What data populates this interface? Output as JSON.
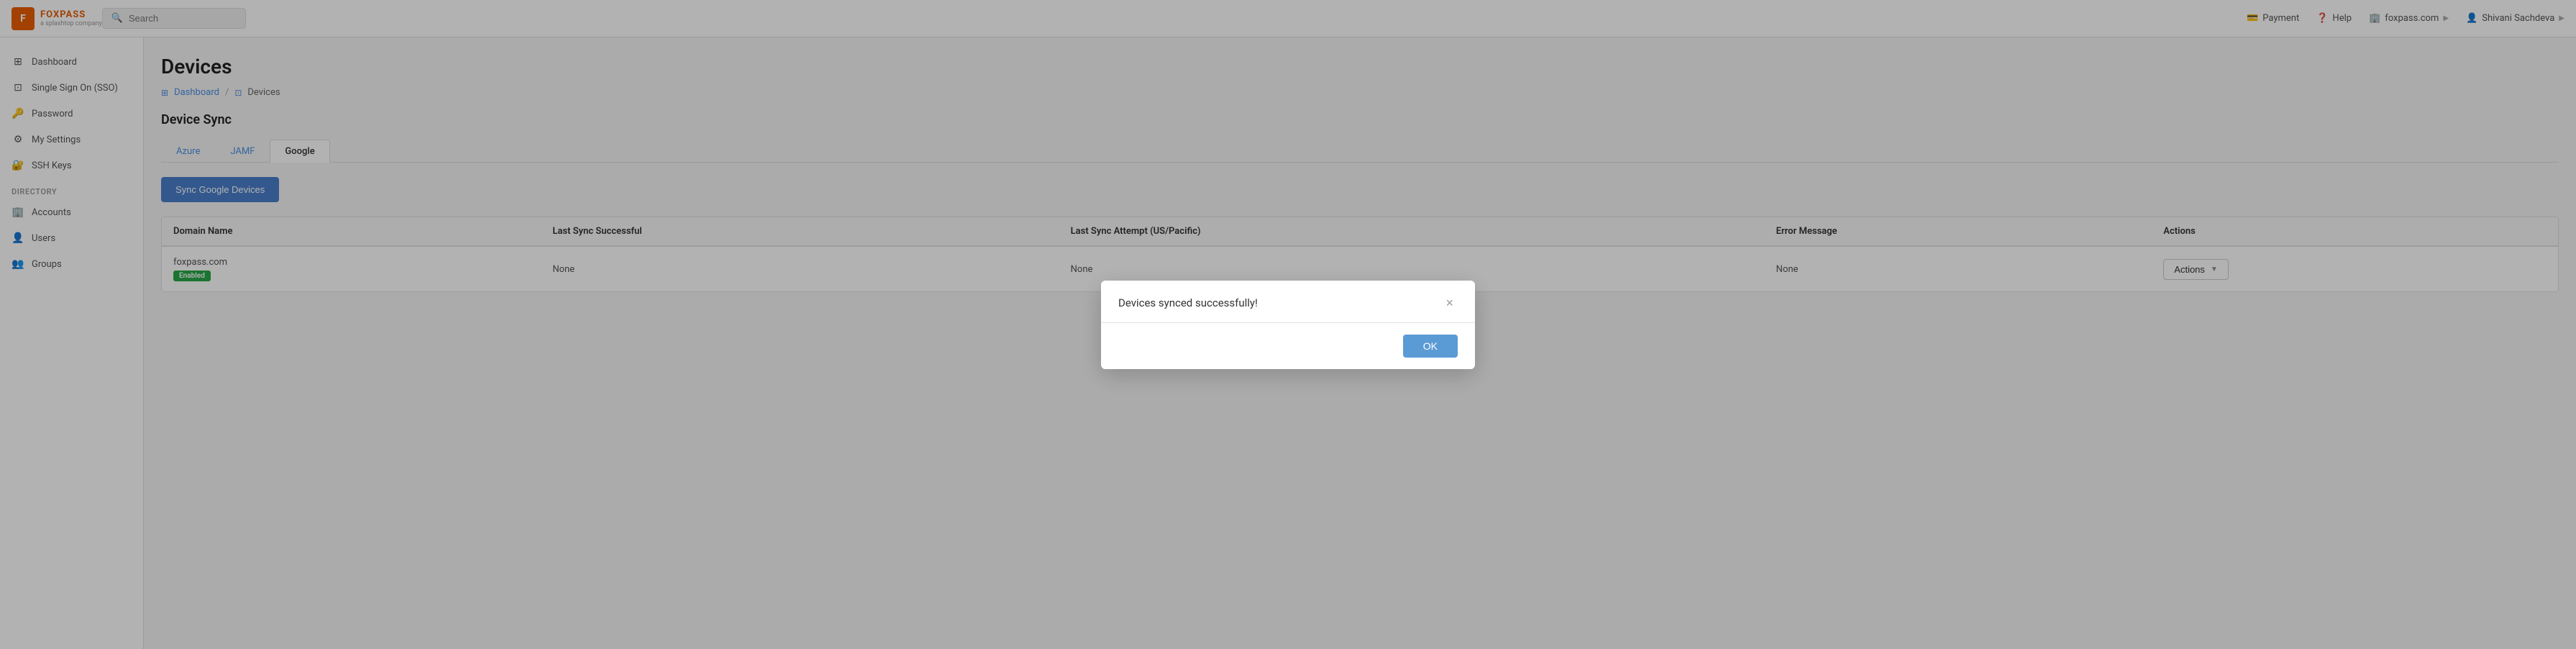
{
  "app": {
    "logo_text": "FOXPASS",
    "logo_sub": "a splashtop company"
  },
  "topnav": {
    "search_placeholder": "Search",
    "payment_label": "Payment",
    "help_label": "Help",
    "domain_label": "foxpass.com",
    "user_label": "Shivani Sachdeva"
  },
  "sidebar": {
    "items": [
      {
        "id": "dashboard",
        "label": "Dashboard",
        "icon": "⊞"
      },
      {
        "id": "sso",
        "label": "Single Sign On (SSO)",
        "icon": "⊡"
      },
      {
        "id": "password",
        "label": "Password",
        "icon": "🔑"
      },
      {
        "id": "my-settings",
        "label": "My Settings",
        "icon": "⚙"
      },
      {
        "id": "ssh-keys",
        "label": "SSH Keys",
        "icon": "🔐"
      }
    ],
    "directory_label": "DIRECTORY",
    "directory_items": [
      {
        "id": "accounts",
        "label": "Accounts",
        "icon": "🏢"
      },
      {
        "id": "users",
        "label": "Users",
        "icon": "👤"
      },
      {
        "id": "groups",
        "label": "Groups",
        "icon": "👥"
      }
    ]
  },
  "page": {
    "title": "Devices",
    "breadcrumb_home": "Dashboard",
    "breadcrumb_current": "Devices",
    "section_title": "Device Sync"
  },
  "tabs": [
    {
      "id": "azure",
      "label": "Azure"
    },
    {
      "id": "jamf",
      "label": "JAMF",
      "active": true,
      "blue": true
    },
    {
      "id": "google",
      "label": "Google",
      "selected": true
    }
  ],
  "sync_button_label": "Sync Google Devices",
  "table": {
    "headers": [
      "Domain Name",
      "Last Sync Successful",
      "Last Sync Attempt (US/Pacific)",
      "Error Message",
      "Actions"
    ],
    "rows": [
      {
        "domain": "foxpass.com",
        "badge": "Enabled",
        "last_sync_successful": "None",
        "last_sync_attempt": "None",
        "error_message": "None",
        "actions_label": "Actions"
      }
    ]
  },
  "modal": {
    "message": "Devices synced successfully!",
    "close_label": "×",
    "ok_label": "OK"
  }
}
